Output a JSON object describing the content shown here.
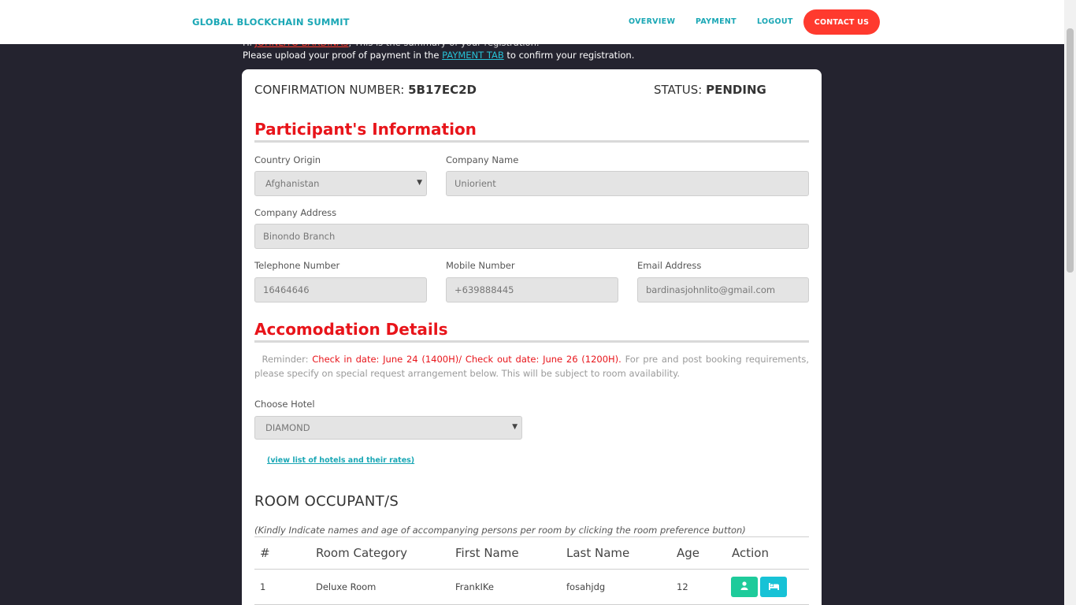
{
  "navbar": {
    "brand": "GLOBAL BLOCKCHAIN SUMMIT",
    "links": [
      "OVERVIEW",
      "PAYMENT",
      "LOGOUT"
    ],
    "contact": "CONTACT US"
  },
  "intro": {
    "line1_prefix": "Hi",
    "line1_name": "JOHNLITO BARDINAS",
    "line1_suffix": ", This is the summary of your registration.",
    "line2_prefix": "Please upload your proof of payment in the",
    "line2_link": "PAYMENT TAB",
    "line2_suffix": "to confirm your registration."
  },
  "header": {
    "confirmation_label": "CONFIRMATION NUMBER:",
    "confirmation_value": "5B17EC2D",
    "status_label": "STATUS:",
    "status_value": "PENDING"
  },
  "participant": {
    "title": "Participant's Information",
    "country_label": "Country Origin",
    "country_value": "Afghanistan",
    "company_label": "Company Name",
    "company_value": "Uniorient",
    "address_label": "Company Address",
    "address_value": "Binondo Branch",
    "telephone_label": "Telephone Number",
    "telephone_value": "16464646",
    "mobile_label": "Mobile Number",
    "mobile_value": "+639888445",
    "email_label": "Email Address",
    "email_value": "bardinasjohnlito@gmail.com"
  },
  "accommodation": {
    "title": "Accomodation Details",
    "reminder_prefix": "Reminder:",
    "reminder_red": "Check in date: June 24 (1400H)/ Check out date: June 26 (1200H).",
    "reminder_rest": "For pre and post booking requirements, please specify on special request arrangement below. This will be subject to room availability.",
    "hotel_label": "Choose Hotel",
    "hotel_value": "DIAMOND",
    "hotel_link": "(view list of hotels and their rates)"
  },
  "occupants": {
    "title": "ROOM OCCUPANT/S",
    "note": "(Kindly Indicate names and age of accompanying persons per room by clicking the room preference button)",
    "columns": [
      "#",
      "Room Category",
      "First Name",
      "Last Name",
      "Age",
      "Action"
    ],
    "rows": [
      {
        "num": "1",
        "category": "Deluxe Room",
        "first": "FrankIKe",
        "last": "fosahjdg",
        "age": "12"
      }
    ]
  },
  "icons": {
    "person_button": "person-icon",
    "bed_button": "bed-icon"
  },
  "colors": {
    "accent_teal": "#1aa7b5",
    "contact_red": "#ff3a2e",
    "section_red": "#e8141a",
    "green_button": "#1ecb9b",
    "cyan_button": "#17c2d6",
    "background": "#24232f"
  }
}
